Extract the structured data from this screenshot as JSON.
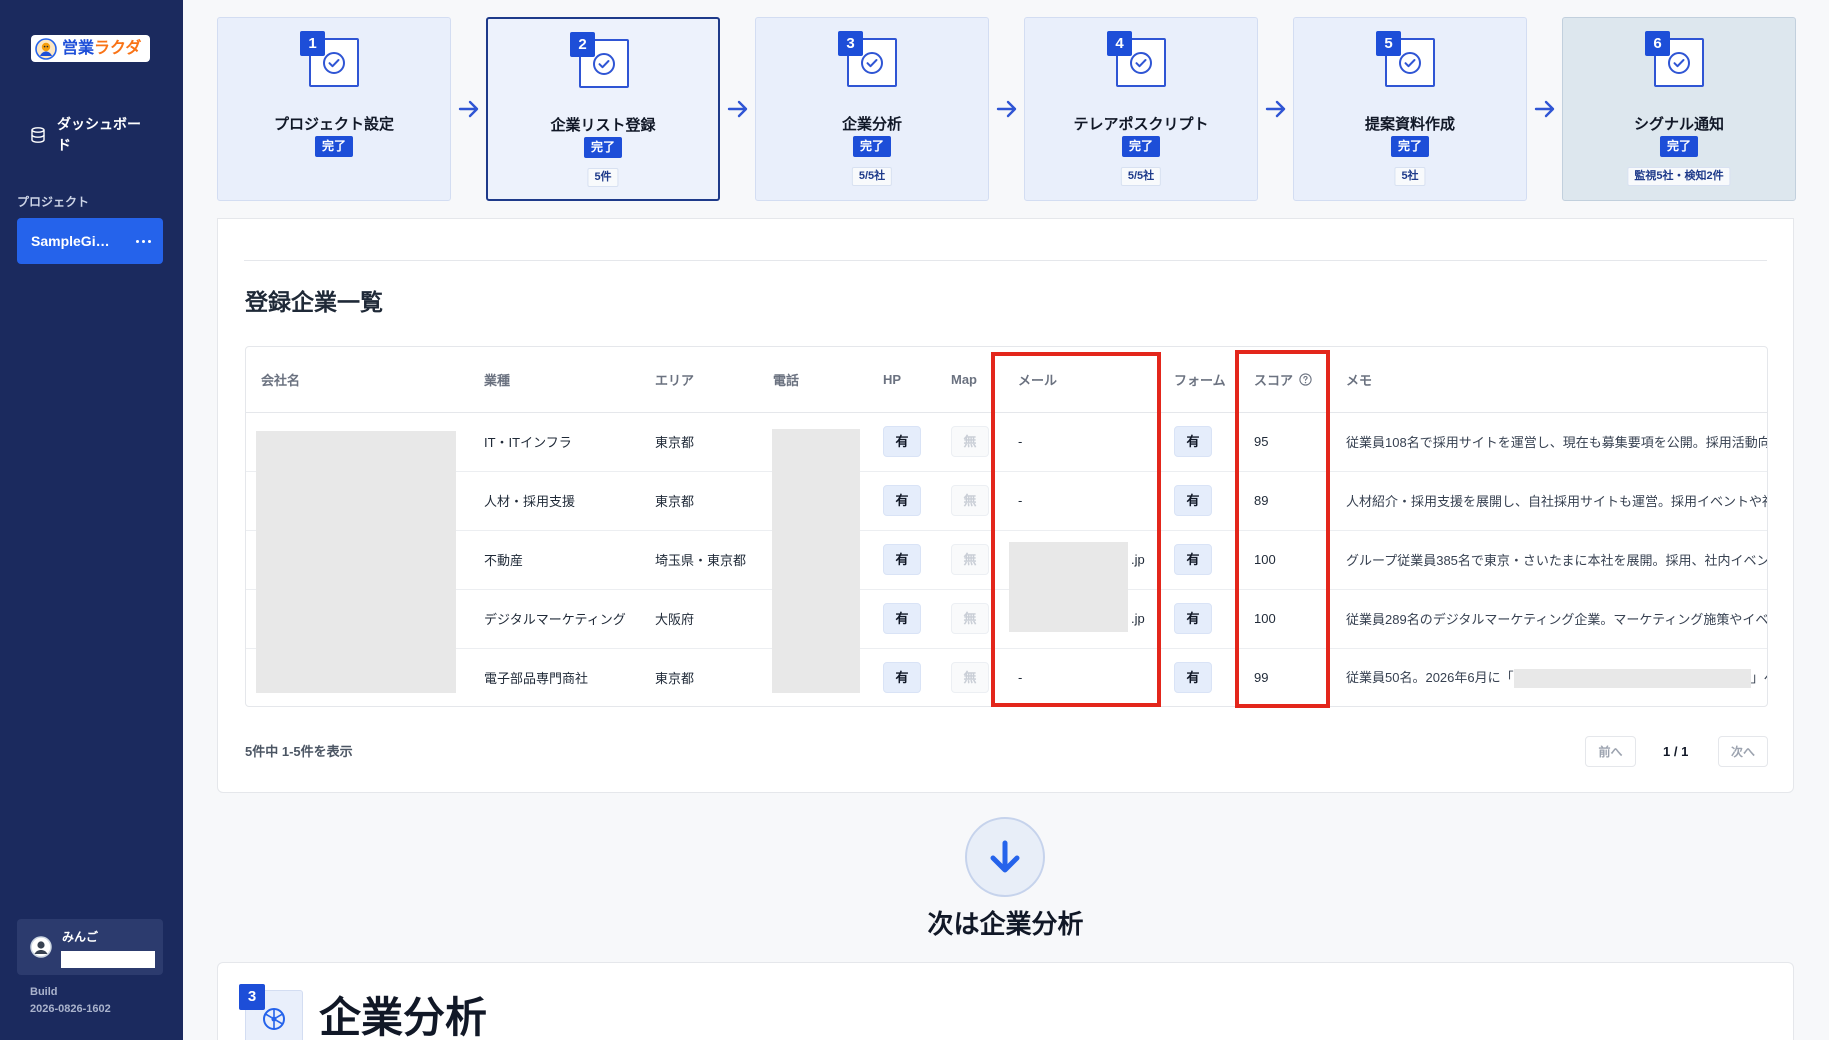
{
  "app": {
    "logo_primary": "営業",
    "logo_accent": "ラクダ",
    "logo_icon": "camel-mascot-icon"
  },
  "sidebar": {
    "dashboard": {
      "label": "ダッシュボード",
      "icon": "database-icon"
    },
    "section_label": "プロジェクト",
    "project": {
      "name": "SampleGi…",
      "menu_icon": "more-icon"
    },
    "user": {
      "name": "みんご",
      "avatar_icon": "avatar"
    },
    "build": {
      "label": "Build",
      "id": "2026-0826-1602"
    }
  },
  "stepper": {
    "current_step": "2",
    "steps": [
      {
        "number": "1",
        "title": "プロジェクト設定",
        "status": "完了"
      },
      {
        "number": "2",
        "title": "企業リスト登録",
        "status": "完了",
        "detail": "5件"
      },
      {
        "number": "3",
        "title": "企業分析",
        "status": "完了",
        "detail": "5/5社"
      },
      {
        "number": "4",
        "title": "テレアポスクリプト",
        "status": "完了",
        "detail": "5/5社"
      },
      {
        "number": "5",
        "title": "提案資料作成",
        "status": "完了",
        "detail": "5社"
      },
      {
        "number": "6",
        "title": "シグナル通知",
        "status": "完了",
        "detail": "監視5社・検知2件"
      }
    ]
  },
  "company_list": {
    "title": "登録企業一覧",
    "columns": [
      {
        "label": "会社名"
      },
      {
        "label": "業種"
      },
      {
        "label": "エリア"
      },
      {
        "label": "電話"
      },
      {
        "label": "HP"
      },
      {
        "label": "Map"
      },
      {
        "label": "メール"
      },
      {
        "label": "フォーム"
      },
      {
        "label": "スコア",
        "icon": "help-icon"
      },
      {
        "label": "メモ"
      }
    ],
    "rows": [
      {
        "industry": "IT・ITインフラ",
        "area": "東京都",
        "hp": "有",
        "map": "無",
        "email": "-",
        "form": "有",
        "score": "95",
        "memo": "従業員108名で採用サイトを運営し、現在も募集要項を公開。採用活動向"
      },
      {
        "industry": "人材・採用支援",
        "area": "東京都",
        "hp": "有",
        "map": "無",
        "email": "-",
        "form": "有",
        "score": "89",
        "memo": "人材紹介・採用支援を展開し、自社採用サイトも運営。採用イベントや社"
      },
      {
        "industry": "不動産",
        "area": "埼玉県・東京都",
        "hp": "有",
        "map": "無",
        "email": ".jp",
        "email_masked": true,
        "form": "有",
        "score": "100",
        "memo": "グループ従業員385名で東京・さいたまに本社を展開。採用、社内イベン"
      },
      {
        "industry": "デジタルマーケティング",
        "area": "大阪府",
        "hp": "有",
        "map": "無",
        "email": ".jp",
        "email_masked": true,
        "form": "有",
        "score": "100",
        "memo": "従業員289名のデジタルマーケティング企業。マーケティング施策やイベ"
      },
      {
        "industry": "電子部品専門商社",
        "area": "東京都",
        "hp": "有",
        "map": "無",
        "email": "-",
        "form": "有",
        "score": "99",
        "memo": "従業員50名。2026年6月に「",
        "memo_after": "」へ"
      }
    ],
    "summary": "5件中 1-5件を表示",
    "pagination": {
      "prev": "前へ",
      "page": "1 / 1",
      "next": "次へ"
    }
  },
  "next_step": {
    "label": "次は企業分析",
    "icon": "arrow-down-icon"
  },
  "analysis_section": {
    "number": "3",
    "title": "企業分析",
    "icon": "network-icon"
  },
  "colors": {
    "sidebar": "#1b2a5e",
    "primary": "#1d4ed8",
    "project_active": "#2563eb",
    "highlight_box": "#e3261b",
    "logo_accent": "#f97316",
    "step_card": "#e9effb"
  }
}
